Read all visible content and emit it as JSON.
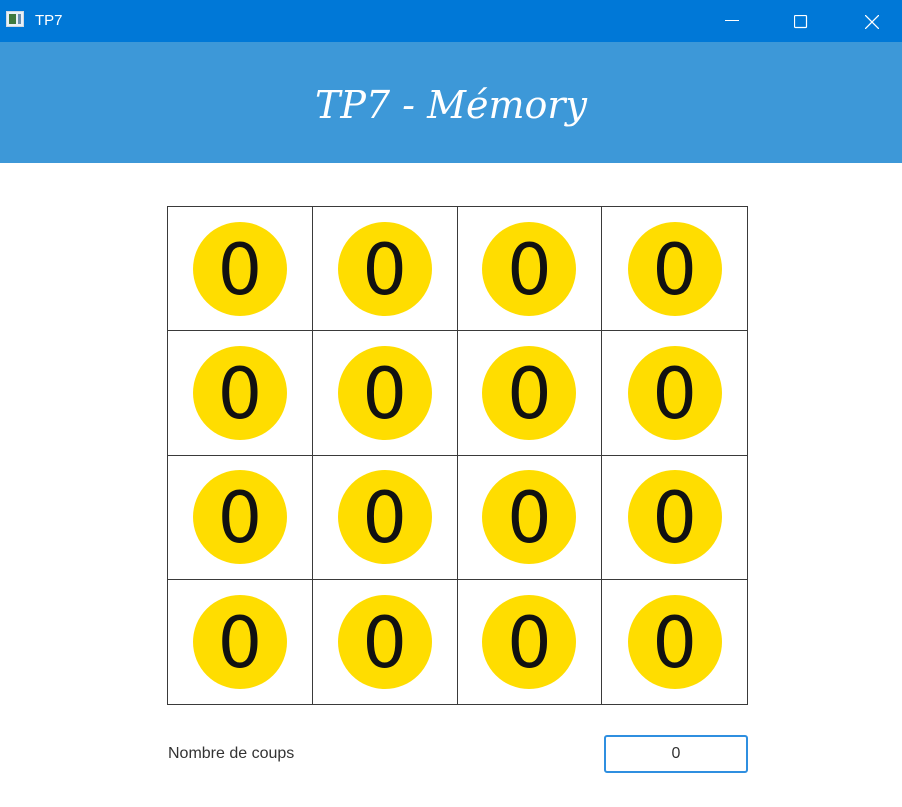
{
  "window": {
    "title": "TP7",
    "accent_color": "#0078d7",
    "controls": {
      "minimize_icon": "minimize-icon",
      "maximize_icon": "maximize-icon",
      "close_icon": "close-icon"
    }
  },
  "header": {
    "title": "TP7 - Mémory",
    "background_color": "#3d98d8"
  },
  "board": {
    "rows": 4,
    "columns": 4,
    "card_color": "#ffdd00",
    "cards": [
      {
        "value": "0"
      },
      {
        "value": "0"
      },
      {
        "value": "0"
      },
      {
        "value": "0"
      },
      {
        "value": "0"
      },
      {
        "value": "0"
      },
      {
        "value": "0"
      },
      {
        "value": "0"
      },
      {
        "value": "0"
      },
      {
        "value": "0"
      },
      {
        "value": "0"
      },
      {
        "value": "0"
      },
      {
        "value": "0"
      },
      {
        "value": "0"
      },
      {
        "value": "0"
      },
      {
        "value": "0"
      }
    ]
  },
  "footer": {
    "moves_label": "Nombre de coups",
    "moves_value": "0"
  }
}
